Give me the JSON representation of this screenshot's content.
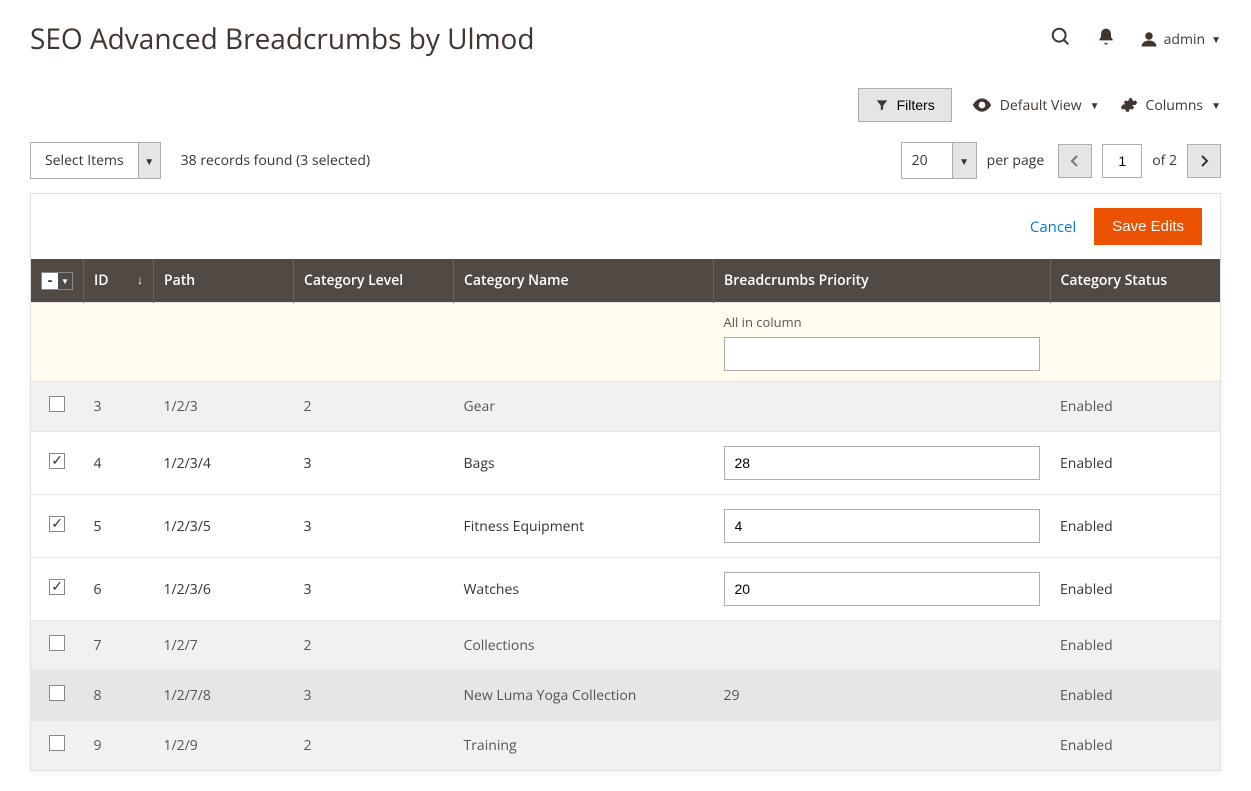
{
  "page_title": "SEO Advanced Breadcrumbs by Ulmod",
  "user_name": "admin",
  "toolbar": {
    "filters": "Filters",
    "default_view": "Default View",
    "columns": "Columns"
  },
  "select_items_label": "Select Items",
  "records_found": "38 records found (3 selected)",
  "page_size": "20",
  "per_page_label": "per page",
  "current_page": "1",
  "of_label": "of 2",
  "edit_actions": {
    "cancel": "Cancel",
    "save": "Save Edits"
  },
  "columns_hdr": {
    "id": "ID",
    "path": "Path",
    "level": "Category Level",
    "name": "Category Name",
    "priority": "Breadcrumbs Priority",
    "status": "Category Status"
  },
  "all_in_column_label": "All in column",
  "rows": [
    {
      "checked": false,
      "editable": false,
      "id": "3",
      "path": "1/2/3",
      "level": "2",
      "name": "Gear",
      "priority": "",
      "status": "Enabled",
      "shade": "gray"
    },
    {
      "checked": true,
      "editable": true,
      "id": "4",
      "path": "1/2/3/4",
      "level": "3",
      "name": "Bags",
      "priority": "28",
      "status": "Enabled",
      "shade": "white"
    },
    {
      "checked": true,
      "editable": true,
      "id": "5",
      "path": "1/2/3/5",
      "level": "3",
      "name": "Fitness Equipment",
      "priority": "4",
      "status": "Enabled",
      "shade": "white"
    },
    {
      "checked": true,
      "editable": true,
      "id": "6",
      "path": "1/2/3/6",
      "level": "3",
      "name": "Watches",
      "priority": "20",
      "status": "Enabled",
      "shade": "white"
    },
    {
      "checked": false,
      "editable": false,
      "id": "7",
      "path": "1/2/7",
      "level": "2",
      "name": "Collections",
      "priority": "",
      "status": "Enabled",
      "shade": "gray"
    },
    {
      "checked": false,
      "editable": false,
      "id": "8",
      "path": "1/2/7/8",
      "level": "3",
      "name": "New Luma Yoga Collection",
      "priority": "29",
      "status": "Enabled",
      "shade": "darkgray"
    },
    {
      "checked": false,
      "editable": false,
      "id": "9",
      "path": "1/2/9",
      "level": "2",
      "name": "Training",
      "priority": "",
      "status": "Enabled",
      "shade": "gray"
    }
  ]
}
